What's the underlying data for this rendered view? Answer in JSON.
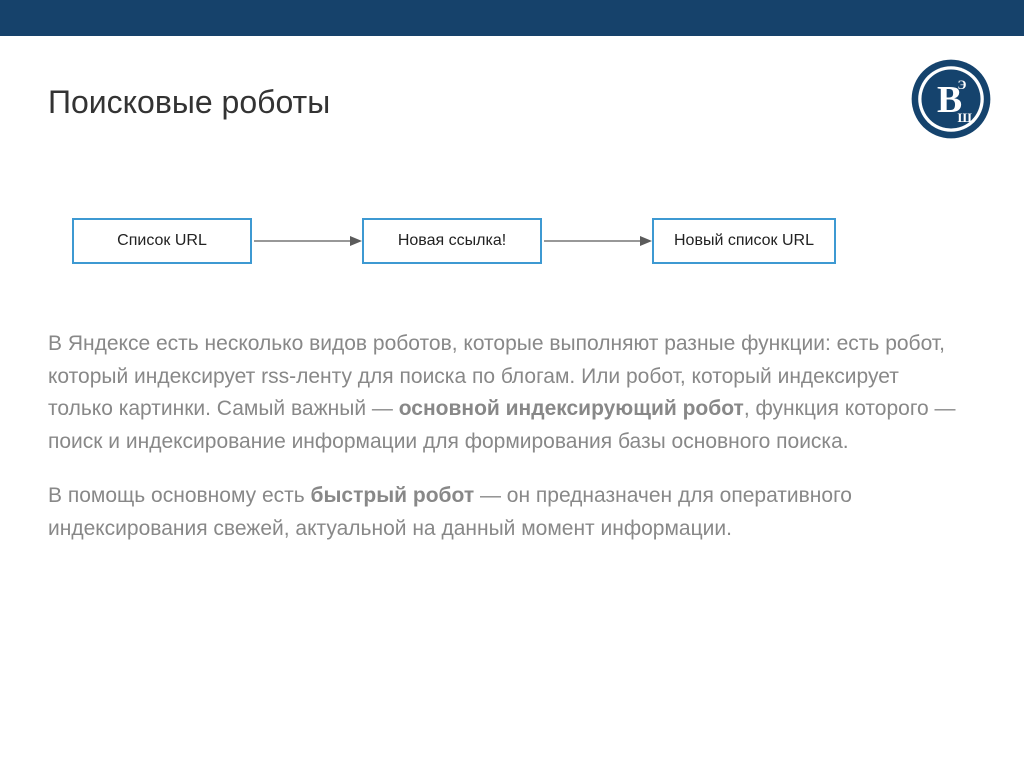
{
  "title": "Поисковые роботы",
  "diagram": {
    "box1": "Список URL",
    "box2": "Новая ссылка!",
    "box3": "Новый список URL"
  },
  "paragraphs": {
    "p1a": "В Яндексе есть несколько видов роботов, которые выполняют разные функции: есть робот, который индексирует rss-ленту для поиска по блогам. Или робот, который индексирует только картинки. Самый важный — ",
    "p1b": "основной индексирующий робот",
    "p1c": ", функция которого — поиск и индексирование информации для формирования базы основного поиска.",
    "p2a": "В помощь основному есть ",
    "p2b": "быстрый робот",
    "p2c": " — он предназначен для оперативного индексирования свежей, актуальной на данный момент информации."
  }
}
